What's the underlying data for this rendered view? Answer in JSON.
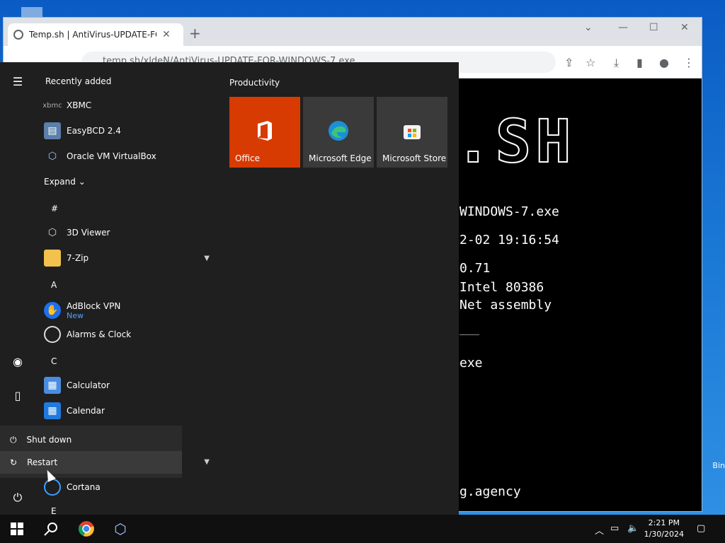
{
  "desktop": {
    "recycle_label": "Bin"
  },
  "browser": {
    "tab_title": "Temp.sh | AntiVirus-UPDATE-FOR",
    "tab_close": "✕",
    "new_tab": "+",
    "url": "temp.sh/xldeN/AntiVirus-UPDATE-FOR-WINDOWS-7.exe",
    "page_logo": ".SH",
    "page_lines": [
      "WINDOWS-7.exe",
      "2-02 19:16:54",
      "      0.71",
      "  Intel 80386",
      " Net assembly",
      "exe",
      "g.agency"
    ]
  },
  "start_menu": {
    "recently_added_label": "Recently added",
    "recent_apps": [
      "XBMC",
      "EasyBCD 2.4",
      "Oracle VM VirtualBox"
    ],
    "expand_label": "Expand",
    "sections": {
      "hash": "#",
      "a": "A",
      "c": "C",
      "e": "E"
    },
    "apps": {
      "viewer3d": "3D Viewer",
      "zip7": "7-Zip",
      "adblock": "AdBlock VPN",
      "adblock_badge": "New",
      "alarms": "Alarms & Clock",
      "calculator": "Calculator",
      "calendar": "Calendar",
      "cortana": "Cortana"
    },
    "power": {
      "shutdown": "Shut down",
      "restart": "Restart"
    },
    "tiles_group": "Productivity",
    "tiles": {
      "office": "Office",
      "edge": "Microsoft Edge",
      "store": "Microsoft Store"
    },
    "colors": {
      "office_tile": "#d83b01",
      "tile": "#3a3a3a",
      "menu_bg": "#1f1f1f"
    }
  },
  "taskbar": {
    "time": "2:21 PM",
    "date": "1/30/2024"
  }
}
